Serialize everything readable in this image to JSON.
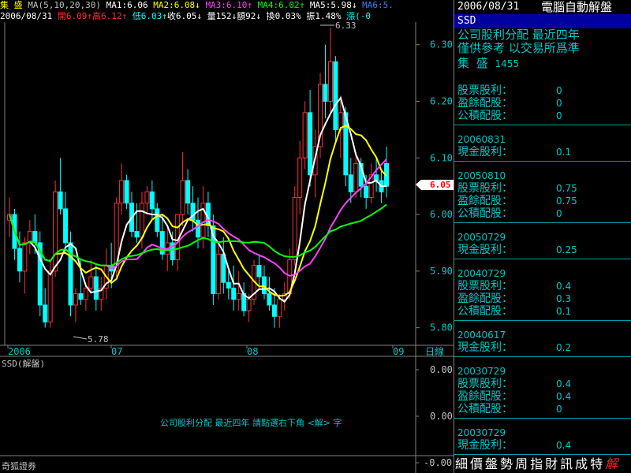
{
  "header": {
    "stock_name": "集 盛",
    "ma_def": "MA(5,10,20,30)",
    "ma1": "MA1:6.06",
    "ma2": "MA2:6.08↓",
    "ma3": "MA3:6.10↑",
    "ma4": "MA4:6.02↑",
    "ma5": "MA5:5.98↓",
    "ma6": "MA6:5.",
    "date": "2006/08/31",
    "open": "開6.09↑",
    "high": "高6.12↑",
    "low": "低6.03↑",
    "close": "收6.05↓",
    "volume": "量152↓",
    "amount": "額92↓",
    "turnover": "換0.03%",
    "amplitude": "振1.48%",
    "change": "漲(-0"
  },
  "chart": {
    "price_labels": [
      "6.30",
      "6.20",
      "6.10",
      "6.00",
      "5.90",
      "5.80"
    ],
    "current_price": "6.05",
    "max_label": "6.33",
    "min_label": "5.78",
    "x_labels": [
      "2006",
      "07",
      "08",
      "09"
    ],
    "period_label": "日線",
    "lower_labels": [
      "0.00",
      "0.00",
      "-0.00"
    ]
  },
  "lower_panel": {
    "title": "SSD(解盤)",
    "note": "公司股利分配 最近四年  請點選右下角 <解> 字"
  },
  "broker": "奇狐證券",
  "panel": {
    "date": "2006/08/31",
    "title": "電腦自動解盤",
    "code": "SSD",
    "heading1": "公司股利分配  最近四年",
    "heading2": "僅供參考  以交易所爲準",
    "stock": "集 盛",
    "stock_code": "1455",
    "sections": [
      {
        "date": "",
        "lines": [
          [
            "股票股利：",
            "0"
          ],
          [
            "盈餘配股：",
            "0"
          ],
          [
            "公積配股：",
            "0"
          ]
        ]
      },
      {
        "date": "20060831",
        "lines": [
          [
            "現金股利：",
            "0.1"
          ]
        ]
      },
      {
        "date": "20050810",
        "lines": [
          [
            "股票股利：",
            "0.75"
          ],
          [
            "盈餘配股：",
            "0.75"
          ],
          [
            "公積配股：",
            "0"
          ]
        ]
      },
      {
        "date": "20050729",
        "lines": [
          [
            "現金股利：",
            "0.25"
          ]
        ]
      },
      {
        "date": "20040729",
        "lines": [
          [
            "股票股利：",
            "0.4"
          ],
          [
            "盈餘配股：",
            "0.3"
          ],
          [
            "公積配股：",
            "0.1"
          ]
        ]
      },
      {
        "date": "20040617",
        "lines": [
          [
            "現金股利：",
            "0.2"
          ]
        ]
      },
      {
        "date": "20030729",
        "lines": [
          [
            "股票股利：",
            "0.4"
          ],
          [
            "盈餘配股：",
            "0.4"
          ],
          [
            "公積配股：",
            "0"
          ]
        ]
      },
      {
        "date": "20030729",
        "lines": [
          [
            "現金股利：",
            "0.4"
          ]
        ]
      }
    ],
    "tabs": [
      "細",
      "價",
      "盤",
      "勢",
      "周",
      "指",
      "財",
      "訊",
      "成",
      "特",
      "解"
    ],
    "active_tab": "解"
  },
  "chart_data": {
    "type": "candlestick",
    "y_range": [
      5.78,
      6.34
    ],
    "x_labels": [
      "2006",
      "07",
      "08",
      "09"
    ],
    "candles": [
      [
        5.99,
        6.03,
        5.96,
        6.0
      ],
      [
        6.0,
        6.01,
        5.92,
        5.94
      ],
      [
        5.94,
        5.97,
        5.88,
        5.9
      ],
      [
        5.9,
        5.96,
        5.86,
        5.95
      ],
      [
        5.95,
        5.99,
        5.93,
        5.97
      ],
      [
        5.97,
        6.0,
        5.93,
        5.95
      ],
      [
        5.95,
        5.97,
        5.82,
        5.84
      ],
      [
        5.84,
        5.87,
        5.8,
        5.81
      ],
      [
        5.81,
        5.92,
        5.8,
        5.9
      ],
      [
        5.9,
        6.06,
        5.89,
        6.04
      ],
      [
        6.04,
        6.1,
        6.0,
        6.01
      ],
      [
        6.01,
        6.04,
        5.93,
        5.95
      ],
      [
        5.95,
        5.97,
        5.82,
        5.84
      ],
      [
        5.84,
        5.87,
        5.81,
        5.86
      ],
      [
        5.86,
        5.92,
        5.84,
        5.85
      ],
      [
        5.85,
        5.88,
        5.83,
        5.87
      ],
      [
        5.87,
        5.92,
        5.86,
        5.89
      ],
      [
        5.89,
        5.91,
        5.83,
        5.85
      ],
      [
        5.85,
        5.89,
        5.83,
        5.87
      ],
      [
        5.87,
        5.94,
        5.85,
        5.91
      ],
      [
        5.91,
        5.95,
        5.87,
        5.9
      ],
      [
        5.9,
        6.03,
        5.89,
        6.02
      ],
      [
        6.02,
        6.09,
        6.0,
        6.06
      ],
      [
        6.06,
        6.07,
        6.01,
        6.02
      ],
      [
        6.02,
        6.04,
        5.96,
        5.97
      ],
      [
        5.97,
        6.02,
        5.95,
        5.96
      ],
      [
        5.96,
        6.04,
        5.94,
        6.02
      ],
      [
        6.02,
        6.05,
        6.0,
        6.04
      ],
      [
        6.04,
        6.06,
        5.99,
        6.01
      ],
      [
        6.01,
        6.02,
        5.96,
        5.97
      ],
      [
        5.97,
        6.0,
        5.92,
        5.93
      ],
      [
        5.93,
        5.98,
        5.9,
        5.95
      ],
      [
        5.95,
        5.97,
        5.91,
        5.92
      ],
      [
        5.92,
        6.0,
        5.9,
        6.0
      ],
      [
        6.0,
        6.11,
        5.98,
        6.06
      ],
      [
        6.06,
        6.08,
        6.0,
        6.02
      ],
      [
        6.02,
        6.05,
        5.97,
        5.99
      ],
      [
        5.99,
        6.03,
        5.94,
        5.96
      ],
      [
        5.96,
        6.05,
        5.94,
        6.02
      ],
      [
        6.02,
        6.04,
        5.96,
        5.98
      ],
      [
        5.98,
        6.0,
        5.84,
        5.86
      ],
      [
        5.86,
        5.95,
        5.85,
        5.93
      ],
      [
        5.93,
        5.96,
        5.86,
        5.88
      ],
      [
        5.88,
        5.9,
        5.85,
        5.87
      ],
      [
        5.87,
        5.91,
        5.83,
        5.85
      ],
      [
        5.85,
        5.9,
        5.83,
        5.86
      ],
      [
        5.86,
        5.88,
        5.82,
        5.83
      ],
      [
        5.83,
        5.86,
        5.81,
        5.85
      ],
      [
        5.85,
        5.92,
        5.84,
        5.91
      ],
      [
        5.91,
        5.93,
        5.87,
        5.89
      ],
      [
        5.89,
        5.91,
        5.85,
        5.86
      ],
      [
        5.86,
        5.89,
        5.83,
        5.84
      ],
      [
        5.84,
        5.87,
        5.8,
        5.82
      ],
      [
        5.82,
        5.86,
        5.8,
        5.85
      ],
      [
        5.85,
        5.88,
        5.83,
        5.86
      ],
      [
        5.86,
        5.94,
        5.85,
        5.92
      ],
      [
        5.92,
        6.05,
        5.91,
        6.03
      ],
      [
        6.03,
        6.13,
        6.0,
        6.1
      ],
      [
        6.1,
        6.2,
        6.08,
        6.18
      ],
      [
        6.18,
        6.22,
        6.05,
        6.07
      ],
      [
        6.07,
        6.15,
        6.03,
        6.12
      ],
      [
        6.12,
        6.25,
        6.1,
        6.23
      ],
      [
        6.23,
        6.3,
        6.17,
        6.2
      ],
      [
        6.2,
        6.33,
        6.18,
        6.27
      ],
      [
        6.27,
        6.28,
        6.13,
        6.15
      ],
      [
        6.15,
        6.21,
        6.1,
        6.18
      ],
      [
        6.18,
        6.19,
        6.05,
        6.07
      ],
      [
        6.07,
        6.1,
        6.02,
        6.04
      ],
      [
        6.04,
        6.11,
        6.03,
        6.09
      ],
      [
        6.09,
        6.1,
        6.03,
        6.05
      ],
      [
        6.05,
        6.07,
        6.01,
        6.03
      ],
      [
        6.03,
        6.09,
        6.02,
        6.07
      ],
      [
        6.07,
        6.1,
        6.04,
        6.06
      ],
      [
        6.06,
        6.08,
        6.02,
        6.04
      ],
      [
        6.09,
        6.12,
        6.03,
        6.05
      ]
    ],
    "series": [
      {
        "name": "MA1",
        "color": "#ffffff"
      },
      {
        "name": "MA2",
        "color": "#ffff00"
      },
      {
        "name": "MA3",
        "color": "#ff40ff"
      },
      {
        "name": "MA4",
        "color": "#00ff00"
      }
    ]
  }
}
